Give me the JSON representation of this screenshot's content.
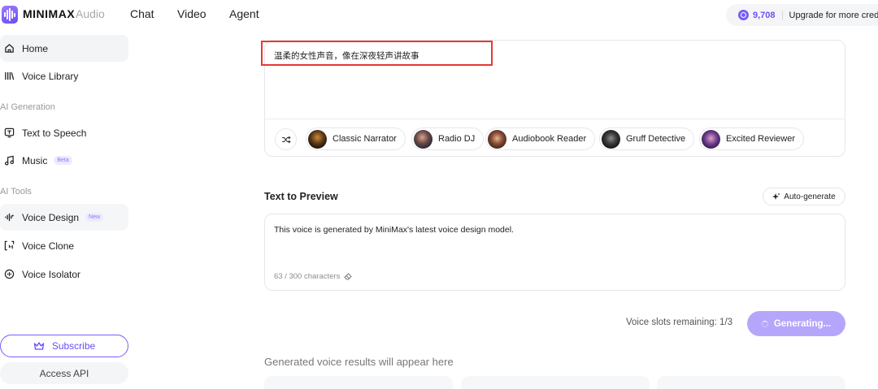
{
  "header": {
    "brand": "MINIMAX",
    "brand_sub": "Audio",
    "nav": [
      "Chat",
      "Video",
      "Agent"
    ],
    "credits": "9,708",
    "upgrade": "Upgrade for more cred",
    "accent": "#6f4ef2"
  },
  "sidebar": {
    "home": "Home",
    "voice_library": "Voice Library",
    "section_ai_generation": "AI Generation",
    "text_to_speech": "Text to Speech",
    "music": "Music",
    "music_badge": "Beta",
    "section_ai_tools": "AI Tools",
    "voice_design": "Voice Design",
    "voice_design_badge": "New",
    "voice_clone": "Voice Clone",
    "voice_isolator": "Voice Isolator",
    "subscribe": "Subscribe",
    "access_api": "Access API"
  },
  "prompt": {
    "text": "温柔的女性声音，像在深夜轻声讲故事",
    "highlight_color": "#e53935"
  },
  "voice_presets": [
    {
      "label": "Classic Narrator",
      "icon": "avatar-classic-narrator"
    },
    {
      "label": "Radio DJ",
      "icon": "avatar-radio-dj"
    },
    {
      "label": "Audiobook Reader",
      "icon": "avatar-audiobook-reader"
    },
    {
      "label": "Gruff Detective",
      "icon": "avatar-gruff-detective"
    },
    {
      "label": "Excited Reviewer",
      "icon": "avatar-excited-reviewer"
    }
  ],
  "preview": {
    "title": "Text to Preview",
    "auto_generate": "Auto-generate",
    "text": "This voice is generated by MiniMax's latest voice design model.",
    "char_count": "63 / 300 characters"
  },
  "actions": {
    "slots": "Voice slots remaining: 1/3",
    "generate": "Generating..."
  },
  "results": {
    "title": "Generated voice results will appear here"
  }
}
